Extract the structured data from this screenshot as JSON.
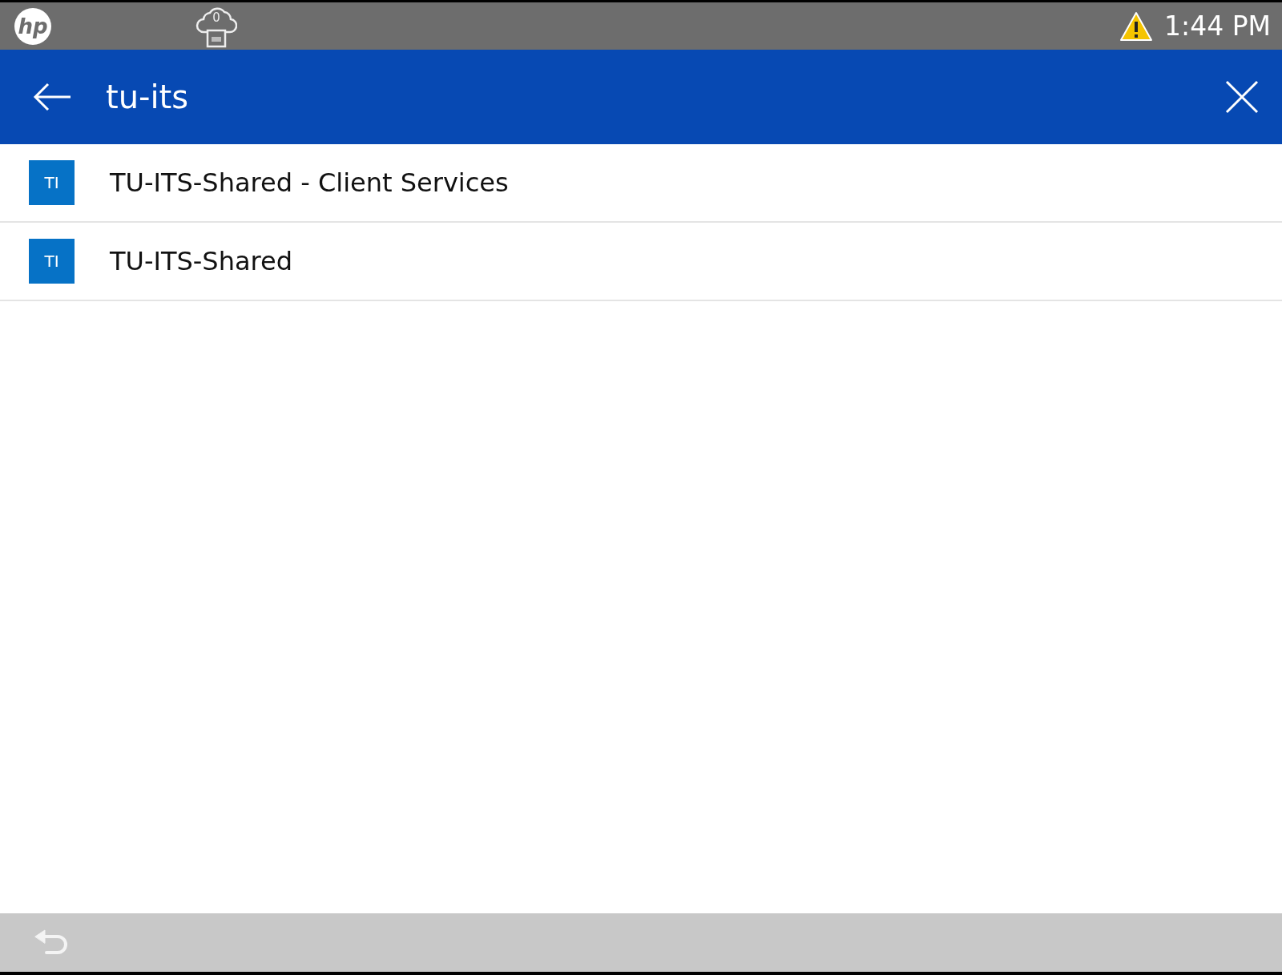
{
  "status_bar": {
    "logo": "hp",
    "job_count": "0",
    "warning": true,
    "time": "1:44 PM"
  },
  "search": {
    "value": "tu-its"
  },
  "results": [
    {
      "initials": "TI",
      "name": "TU-ITS-Shared - Client Services"
    },
    {
      "initials": "TI",
      "name": "TU-ITS-Shared"
    }
  ]
}
